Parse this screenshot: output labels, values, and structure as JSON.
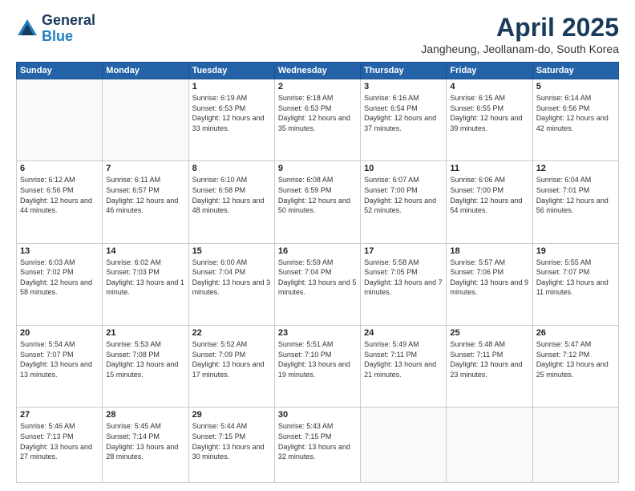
{
  "header": {
    "logo_general": "General",
    "logo_blue": "Blue",
    "month": "April 2025",
    "location": "Jangheung, Jeollanam-do, South Korea"
  },
  "weekdays": [
    "Sunday",
    "Monday",
    "Tuesday",
    "Wednesday",
    "Thursday",
    "Friday",
    "Saturday"
  ],
  "weeks": [
    [
      {
        "day": "",
        "info": ""
      },
      {
        "day": "",
        "info": ""
      },
      {
        "day": "1",
        "info": "Sunrise: 6:19 AM\nSunset: 6:53 PM\nDaylight: 12 hours and 33 minutes."
      },
      {
        "day": "2",
        "info": "Sunrise: 6:18 AM\nSunset: 6:53 PM\nDaylight: 12 hours and 35 minutes."
      },
      {
        "day": "3",
        "info": "Sunrise: 6:16 AM\nSunset: 6:54 PM\nDaylight: 12 hours and 37 minutes."
      },
      {
        "day": "4",
        "info": "Sunrise: 6:15 AM\nSunset: 6:55 PM\nDaylight: 12 hours and 39 minutes."
      },
      {
        "day": "5",
        "info": "Sunrise: 6:14 AM\nSunset: 6:56 PM\nDaylight: 12 hours and 42 minutes."
      }
    ],
    [
      {
        "day": "6",
        "info": "Sunrise: 6:12 AM\nSunset: 6:56 PM\nDaylight: 12 hours and 44 minutes."
      },
      {
        "day": "7",
        "info": "Sunrise: 6:11 AM\nSunset: 6:57 PM\nDaylight: 12 hours and 46 minutes."
      },
      {
        "day": "8",
        "info": "Sunrise: 6:10 AM\nSunset: 6:58 PM\nDaylight: 12 hours and 48 minutes."
      },
      {
        "day": "9",
        "info": "Sunrise: 6:08 AM\nSunset: 6:59 PM\nDaylight: 12 hours and 50 minutes."
      },
      {
        "day": "10",
        "info": "Sunrise: 6:07 AM\nSunset: 7:00 PM\nDaylight: 12 hours and 52 minutes."
      },
      {
        "day": "11",
        "info": "Sunrise: 6:06 AM\nSunset: 7:00 PM\nDaylight: 12 hours and 54 minutes."
      },
      {
        "day": "12",
        "info": "Sunrise: 6:04 AM\nSunset: 7:01 PM\nDaylight: 12 hours and 56 minutes."
      }
    ],
    [
      {
        "day": "13",
        "info": "Sunrise: 6:03 AM\nSunset: 7:02 PM\nDaylight: 12 hours and 58 minutes."
      },
      {
        "day": "14",
        "info": "Sunrise: 6:02 AM\nSunset: 7:03 PM\nDaylight: 13 hours and 1 minute."
      },
      {
        "day": "15",
        "info": "Sunrise: 6:00 AM\nSunset: 7:04 PM\nDaylight: 13 hours and 3 minutes."
      },
      {
        "day": "16",
        "info": "Sunrise: 5:59 AM\nSunset: 7:04 PM\nDaylight: 13 hours and 5 minutes."
      },
      {
        "day": "17",
        "info": "Sunrise: 5:58 AM\nSunset: 7:05 PM\nDaylight: 13 hours and 7 minutes."
      },
      {
        "day": "18",
        "info": "Sunrise: 5:57 AM\nSunset: 7:06 PM\nDaylight: 13 hours and 9 minutes."
      },
      {
        "day": "19",
        "info": "Sunrise: 5:55 AM\nSunset: 7:07 PM\nDaylight: 13 hours and 11 minutes."
      }
    ],
    [
      {
        "day": "20",
        "info": "Sunrise: 5:54 AM\nSunset: 7:07 PM\nDaylight: 13 hours and 13 minutes."
      },
      {
        "day": "21",
        "info": "Sunrise: 5:53 AM\nSunset: 7:08 PM\nDaylight: 13 hours and 15 minutes."
      },
      {
        "day": "22",
        "info": "Sunrise: 5:52 AM\nSunset: 7:09 PM\nDaylight: 13 hours and 17 minutes."
      },
      {
        "day": "23",
        "info": "Sunrise: 5:51 AM\nSunset: 7:10 PM\nDaylight: 13 hours and 19 minutes."
      },
      {
        "day": "24",
        "info": "Sunrise: 5:49 AM\nSunset: 7:11 PM\nDaylight: 13 hours and 21 minutes."
      },
      {
        "day": "25",
        "info": "Sunrise: 5:48 AM\nSunset: 7:11 PM\nDaylight: 13 hours and 23 minutes."
      },
      {
        "day": "26",
        "info": "Sunrise: 5:47 AM\nSunset: 7:12 PM\nDaylight: 13 hours and 25 minutes."
      }
    ],
    [
      {
        "day": "27",
        "info": "Sunrise: 5:46 AM\nSunset: 7:13 PM\nDaylight: 13 hours and 27 minutes."
      },
      {
        "day": "28",
        "info": "Sunrise: 5:45 AM\nSunset: 7:14 PM\nDaylight: 13 hours and 28 minutes."
      },
      {
        "day": "29",
        "info": "Sunrise: 5:44 AM\nSunset: 7:15 PM\nDaylight: 13 hours and 30 minutes."
      },
      {
        "day": "30",
        "info": "Sunrise: 5:43 AM\nSunset: 7:15 PM\nDaylight: 13 hours and 32 minutes."
      },
      {
        "day": "",
        "info": ""
      },
      {
        "day": "",
        "info": ""
      },
      {
        "day": "",
        "info": ""
      }
    ]
  ]
}
